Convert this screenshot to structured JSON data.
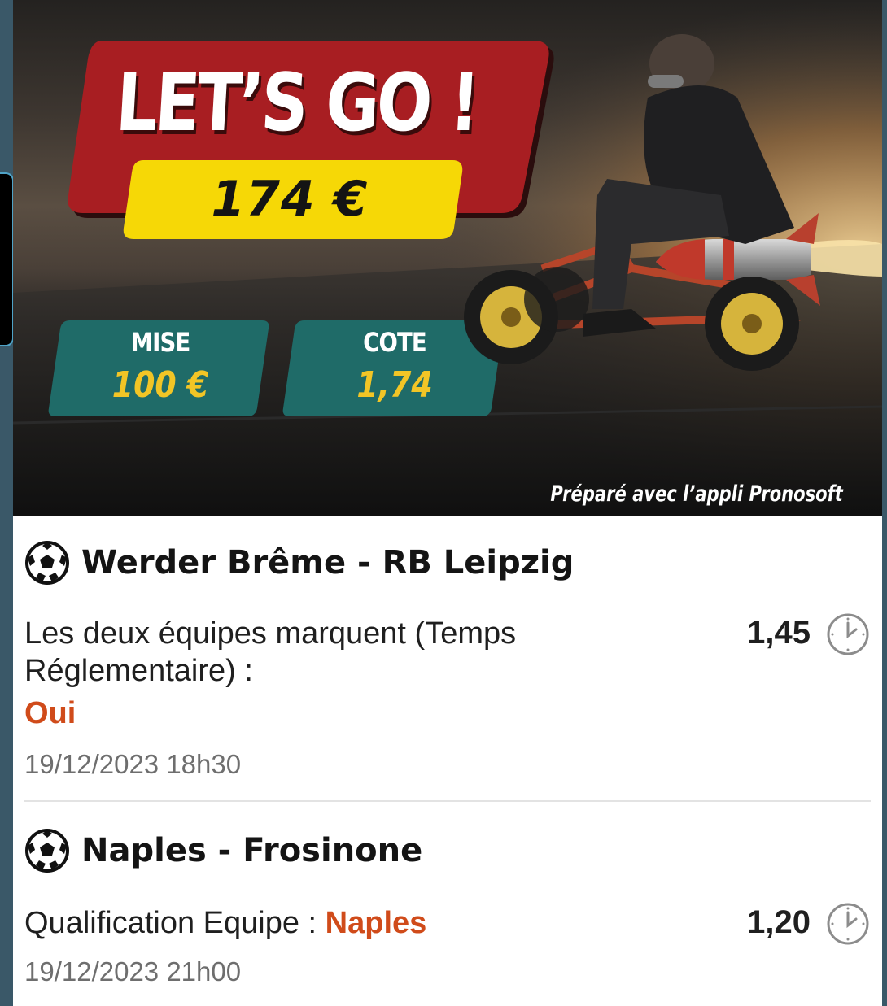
{
  "banner": {
    "title": "LET’S GO !",
    "amount": "174 €",
    "stake_label": "MISE",
    "stake_value": "100 €",
    "odds_label": "COTE",
    "odds_value": "1,74",
    "credit": "Préparé avec l’appli Pronosoft"
  },
  "bets": [
    {
      "sport_icon": "soccer-ball-icon",
      "match": "Werder Brême - RB Leipzig",
      "market": "Les deux équipes marquent (Temps Réglementaire) :",
      "selection": "Oui",
      "odds": "1,45",
      "status_icon": "clock-icon",
      "date": "19/12/2023 18h30"
    },
    {
      "sport_icon": "soccer-ball-icon",
      "match": "Naples - Frosinone",
      "market": "Qualification Equipe :",
      "selection": "Naples",
      "odds": "1,20",
      "status_icon": "clock-icon",
      "date": "19/12/2023 21h00"
    }
  ],
  "colors": {
    "title_box": "#a81e22",
    "amount_box": "#f6d806",
    "stat_box": "#1f6b68",
    "stat_value": "#f2c526",
    "selection": "#d04b1a",
    "date_text": "#6e6e6e"
  }
}
